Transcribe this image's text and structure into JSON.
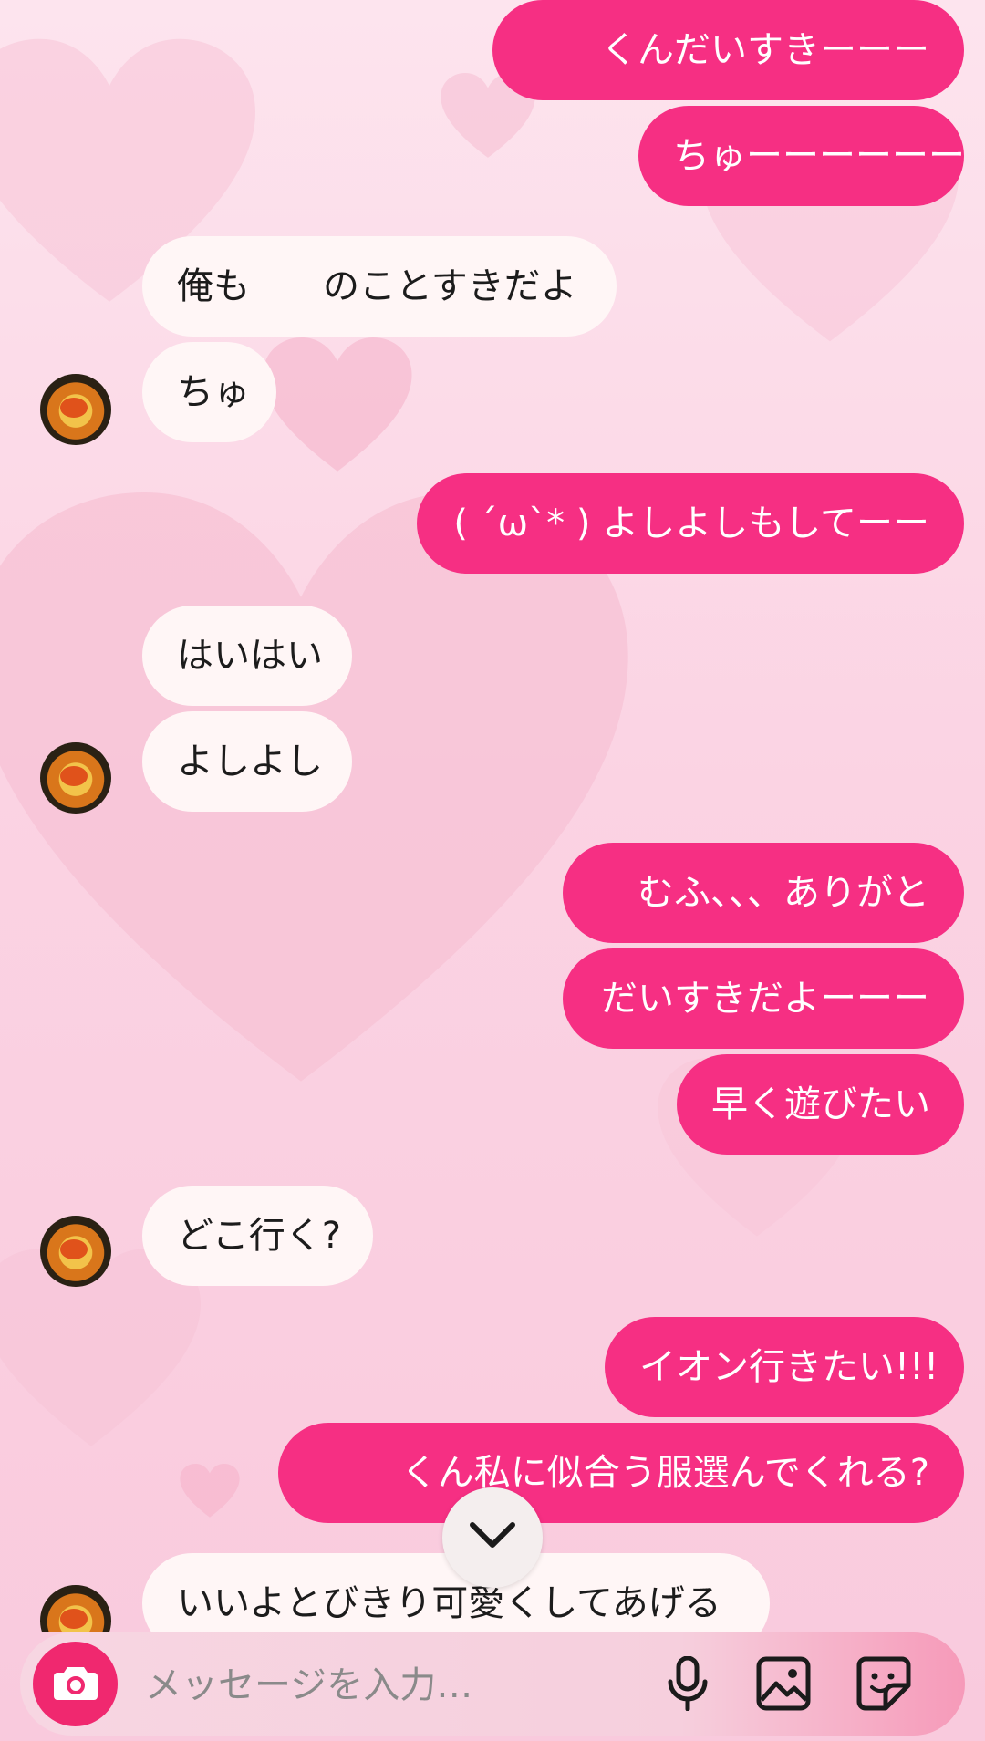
{
  "messages": [
    {
      "side": "out",
      "text": "くんだいすきーーー"
    },
    {
      "side": "out",
      "text": "ちゅーーーーーー"
    },
    {
      "side": "in",
      "text": "俺も　　のことすきだよ"
    },
    {
      "side": "in",
      "text": "ちゅ"
    },
    {
      "side": "out",
      "text": "( ´ω`* ) よしよしもしてーー"
    },
    {
      "side": "in",
      "text": "はいはい"
    },
    {
      "side": "in",
      "text": "よしよし"
    },
    {
      "side": "out",
      "text": "むふ、、、ありがと"
    },
    {
      "side": "out",
      "text": "だいすきだよーーー"
    },
    {
      "side": "out",
      "text": "早く遊びたい"
    },
    {
      "side": "in",
      "text": "どこ行く?"
    },
    {
      "side": "out",
      "text": "イオン行きたい!!!"
    },
    {
      "side": "out",
      "text": "くん私に似合う服選んでくれる?"
    },
    {
      "side": "in",
      "text": "いいよとびきり可愛くしてあげる"
    }
  ],
  "composer": {
    "placeholder": "メッセージを入力…",
    "icons": [
      "camera-icon",
      "microphone-icon",
      "image-icon",
      "sticker-icon"
    ]
  },
  "scroll_button_icon": "chevron-down-icon",
  "colors": {
    "outgoing_bubble": "#f62f83",
    "incoming_bubble": "#fff6f6",
    "camera_button": "#f0286f",
    "background": "#fbd3e3"
  }
}
